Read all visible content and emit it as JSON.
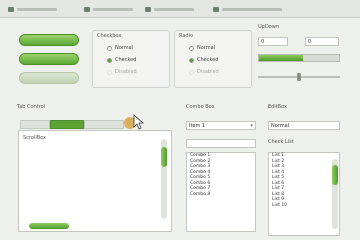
{
  "colors": {
    "accent": "#5ca836",
    "panel": "#f3f4f1",
    "background": "#eef0ec"
  },
  "tabs": [
    {
      "icon": "tab-icon"
    },
    {
      "icon": "tab-icon"
    },
    {
      "icon": "tab-icon"
    },
    {
      "icon": "tab-icon"
    }
  ],
  "buttons": {
    "primary": "",
    "secondary": "",
    "disabled": ""
  },
  "checkbox_group": {
    "title": "Checkbox",
    "items": [
      "Normal",
      "Checked",
      "Disabled"
    ]
  },
  "radio_group": {
    "title": "Radio",
    "items": [
      "Normal",
      "Checked",
      "Disabled"
    ]
  },
  "updown": {
    "title": "UpDown",
    "value_a": "0",
    "value_b": "0",
    "progress": 0.55,
    "slider": 0.5
  },
  "tab_control": {
    "title": "Tab Control",
    "tabs": [
      "",
      "",
      ""
    ],
    "content_label": "ScrollBox"
  },
  "combo": {
    "title": "Combo Box",
    "selected": "Item 1",
    "items": [
      "Combo 1",
      "Combo 2",
      "Combo 3",
      "Combo 4",
      "Combo 5",
      "Combo 6",
      "Combo 7",
      "Combo 8"
    ]
  },
  "editbox": {
    "title": "EditBox",
    "value": "Normal"
  },
  "listbox": {
    "title": "Check List",
    "items": [
      "List 1",
      "List 2",
      "List 3",
      "List 4",
      "List 5",
      "List 6",
      "List 7",
      "List 8",
      "List 9",
      "List 10"
    ]
  }
}
